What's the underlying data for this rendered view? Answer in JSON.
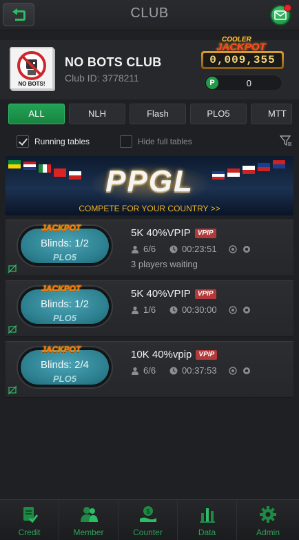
{
  "header": {
    "title": "CLUB"
  },
  "club": {
    "logo_label": "NO BOTS!",
    "name": "NO BOTS CLUB",
    "id_text": "Club ID: 3778211",
    "jackpot_cooler": "COOLER",
    "jackpot_word": "JACKPOT",
    "jackpot_value": "0,009,355",
    "points_badge": "P",
    "points_value": "0"
  },
  "tabs": [
    {
      "label": "ALL",
      "active": true
    },
    {
      "label": "NLH",
      "active": false
    },
    {
      "label": "Flash",
      "active": false
    },
    {
      "label": "PLO5",
      "active": false
    },
    {
      "label": "MTT",
      "active": false
    }
  ],
  "filters": {
    "running_label": "Running tables",
    "running_checked": true,
    "hide_full_label": "Hide full tables",
    "hide_full_checked": false
  },
  "banner": {
    "logo": "PPGL",
    "subtitle": "COMPETE FOR YOUR COUNTRY >>"
  },
  "tables": [
    {
      "jackpot": "JACKPOT",
      "blinds": "Blinds: 1/2",
      "game": "PLO5",
      "title": "5K 40%VPIP",
      "tag": "VPIP",
      "seats": "6/6",
      "time": "00:23:51",
      "waiting": "3 players waiting"
    },
    {
      "jackpot": "JACKPOT",
      "blinds": "Blinds: 1/2",
      "game": "PLO5",
      "title": "5K 40%VPIP",
      "tag": "VPIP",
      "seats": "1/6",
      "time": "00:30:00",
      "waiting": ""
    },
    {
      "jackpot": "JACKPOT",
      "blinds": "Blinds: 2/4",
      "game": "PLO5",
      "title": "10K 40%vpip",
      "tag": "VPIP",
      "seats": "6/6",
      "time": "00:37:53",
      "waiting": ""
    }
  ],
  "nav": [
    {
      "label": "Credit",
      "icon": "credit-icon"
    },
    {
      "label": "Member",
      "icon": "member-icon"
    },
    {
      "label": "Counter",
      "icon": "counter-icon"
    },
    {
      "label": "Data",
      "icon": "data-icon"
    },
    {
      "label": "Admin",
      "icon": "admin-icon"
    }
  ],
  "colors": {
    "accent": "#1f9b4a",
    "jackpot_gold": "#f7d77a",
    "vpip_red": "#b23a3a",
    "chip_teal": "#2b7e8e"
  }
}
